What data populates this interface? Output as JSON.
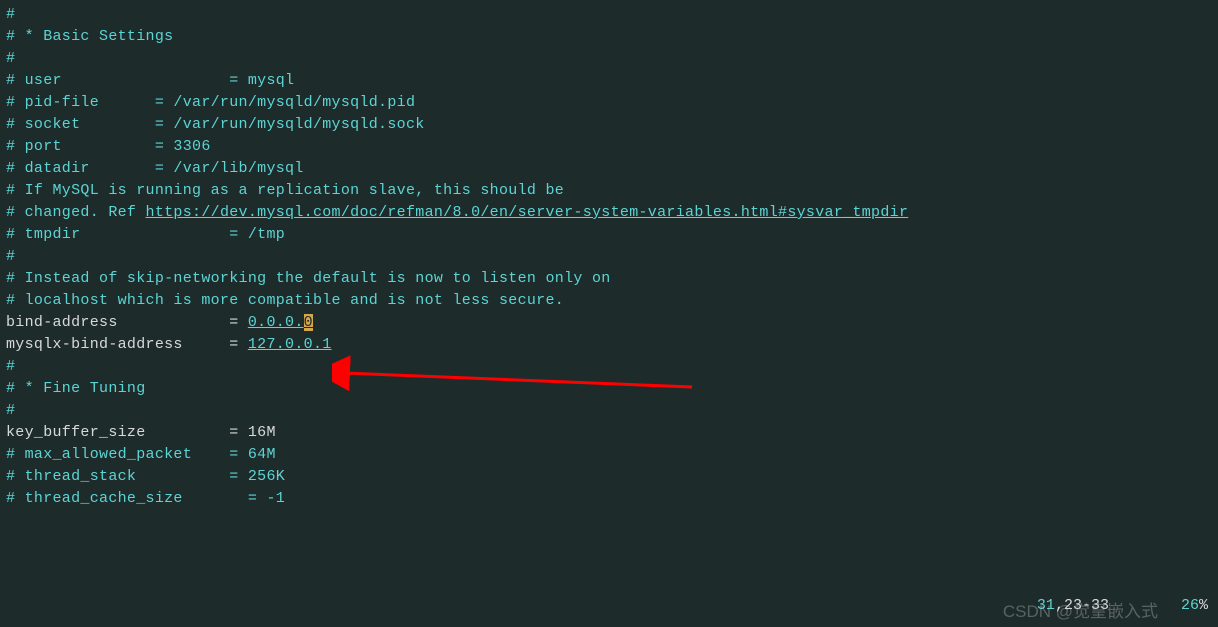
{
  "lines": {
    "l1": "#",
    "l2": "# * Basic Settings",
    "l3": "#",
    "l4": "# user                  = mysql",
    "l5": "# pid-file      = /var/run/mysqld/mysqld.pid",
    "l6": "# socket        = /var/run/mysqld/mysqld.sock",
    "l7": "# port          = 3306",
    "l8": "# datadir       = /var/lib/mysql",
    "l9": "",
    "l10": "",
    "l11": "# If MySQL is running as a replication slave, this should be",
    "l12_pre": "# changed. Ref ",
    "l12_url": "https://dev.mysql.com/doc/refman/8.0/en/server-system-variables.html#sysvar_tmpdir",
    "l13": "# tmpdir                = /tmp",
    "l14": "#",
    "l15": "# Instead of skip-networking the default is now to listen only on",
    "l16": "# localhost which is more compatible and is not less secure.",
    "l17_key": "bind-address            = ",
    "l17_val": "0.0.0.",
    "l17_cursor": "0",
    "l18_key": "mysqlx-bind-address     = ",
    "l18_val": "127.0.0.1",
    "l19": "#",
    "l20": "# * Fine Tuning",
    "l21": "#",
    "l22_key": "key_buffer_size         = 16M",
    "l23": "# max_allowed_packet    = 64M",
    "l24": "# thread_stack          = 256K",
    "l25": "",
    "l26": "# thread_cache_size       = -1"
  },
  "status": {
    "line": "31",
    "col": ",23-33",
    "pct": "26",
    "pctsym": "%"
  },
  "watermark": "CSDN @觉皇嵌入式"
}
